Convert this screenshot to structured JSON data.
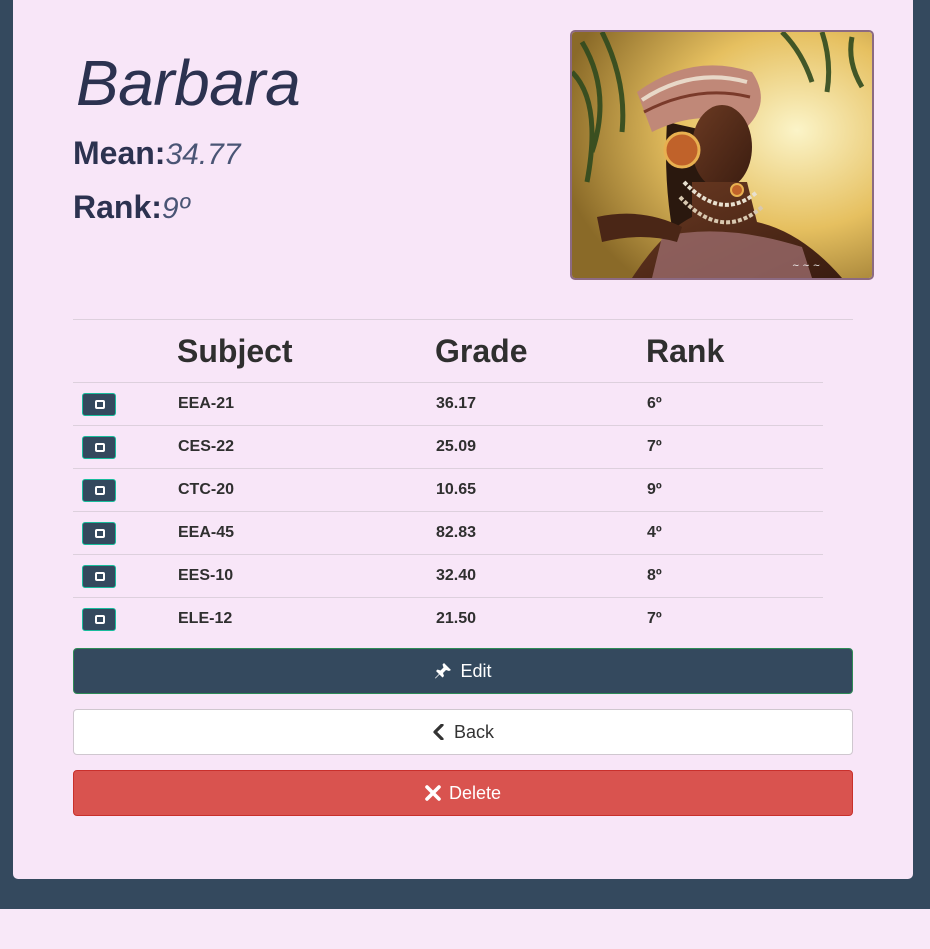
{
  "student": {
    "name": "Barbara",
    "mean_label": "Mean:",
    "mean_value": "34.77",
    "rank_label": "Rank:",
    "rank_value": "9º"
  },
  "portrait": {
    "icon": "portrait-painting"
  },
  "grades_table": {
    "headers": [
      "Subject",
      "Grade",
      "Rank"
    ],
    "rows": [
      {
        "subject": "EEA-21",
        "grade": "36.17",
        "rank": "6º"
      },
      {
        "subject": "CES-22",
        "grade": "25.09",
        "rank": "7º"
      },
      {
        "subject": "CTC-20",
        "grade": "10.65",
        "rank": "9º"
      },
      {
        "subject": "EEA-45",
        "grade": "82.83",
        "rank": "4º"
      },
      {
        "subject": "EES-10",
        "grade": "32.40",
        "rank": "8º"
      },
      {
        "subject": "ELE-12",
        "grade": "21.50",
        "rank": "7º"
      }
    ]
  },
  "actions": {
    "edit_label": "Edit",
    "back_label": "Back",
    "delete_label": "Delete"
  },
  "colors": {
    "page_background": "#f8e6f8",
    "frame": "#34495e",
    "primary": "#34495e",
    "danger": "#d9534f",
    "success_border": "#18bc9c"
  }
}
